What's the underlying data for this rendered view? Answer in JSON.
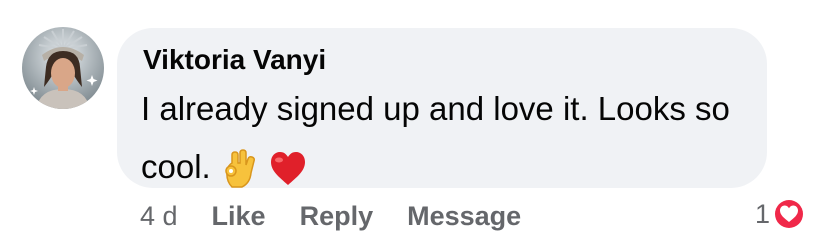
{
  "comment": {
    "author": "Viktoria Vanyi",
    "text": "I already signed up and love it. Looks so cool.",
    "emojis": [
      "ok-hand-emoji",
      "red-heart-emoji"
    ]
  },
  "meta": {
    "time": "4 d",
    "actions": {
      "like": "Like",
      "reply": "Reply",
      "message": "Message"
    }
  },
  "reactions": {
    "count": "1",
    "icon": "heart-reaction-icon",
    "color": "#f02849"
  },
  "colors": {
    "bubble": "#f0f2f5",
    "text": "#050505",
    "secondary": "#65676b"
  }
}
